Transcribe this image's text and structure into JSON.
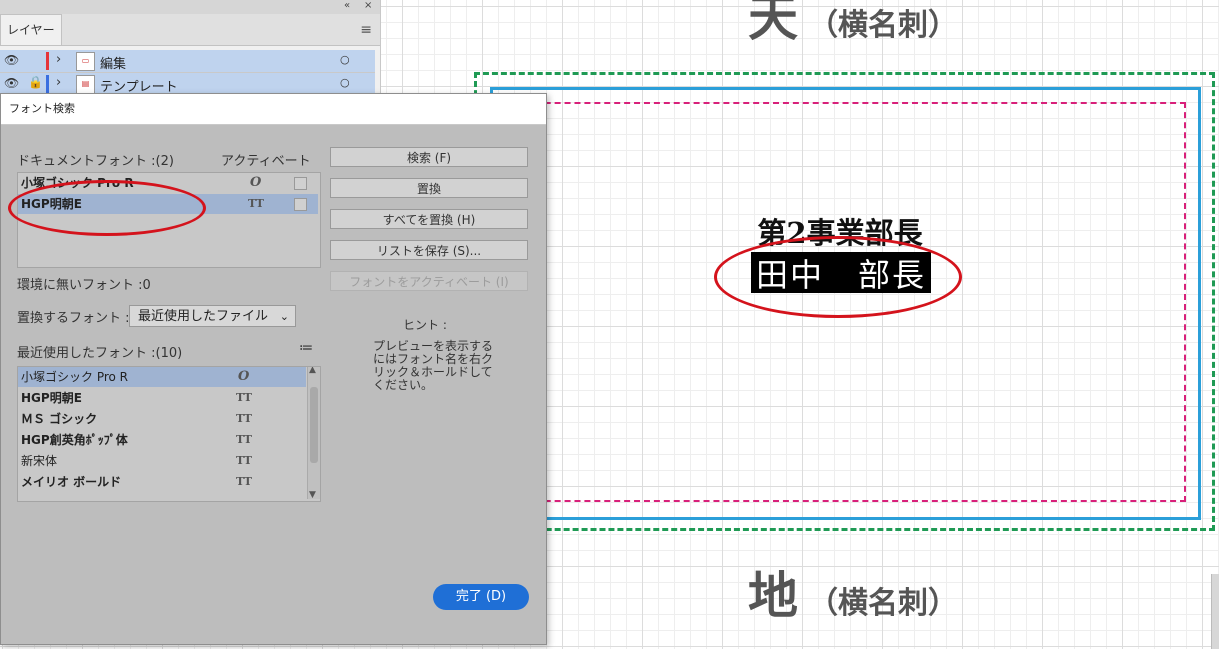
{
  "canvas": {
    "heading_top": {
      "big": "天",
      "small": "（横名刺）"
    },
    "heading_bottom": {
      "big": "地",
      "small": "（横名刺）"
    },
    "card_department": "第2事業部長",
    "card_name": "田中　部長"
  },
  "layers_panel": {
    "tab_label": "レイヤー",
    "collapse_icon": "«",
    "close_icon": "×",
    "menu_icon": "≡",
    "layers": [
      {
        "name": "編集",
        "color": "#e5343a",
        "locked": false
      },
      {
        "name": "テンプレート",
        "color": "#3a6fe0",
        "locked": true
      }
    ]
  },
  "dialog": {
    "title": "フォント検索",
    "document_fonts_label": "ドキュメントフォント :(2)",
    "activate_header": "アクティベート",
    "document_fonts": [
      {
        "name": "小塚ゴシック Pro R",
        "icon": "opentype-icon",
        "selected": false
      },
      {
        "name": "HGP明朝E",
        "icon": "truetype-icon",
        "selected": true
      }
    ],
    "missing_fonts_label": "環境に無いフォント :0",
    "replace_with_label": "置換するフォント :",
    "replace_with_value": "最近使用したファイル",
    "recent_fonts_label": "最近使用したフォント :(10)",
    "recent_fonts": [
      {
        "name": "小塚ゴシック Pro R",
        "icon": "opentype-icon",
        "selected": true
      },
      {
        "name": "HGP明朝E",
        "icon": "truetype-icon",
        "selected": false
      },
      {
        "name": "ＭＳ ゴシック",
        "icon": "truetype-icon",
        "selected": false
      },
      {
        "name": "HGP創英角ﾎﾟｯﾌﾟ体",
        "icon": "truetype-icon",
        "selected": false
      },
      {
        "name": "新宋体",
        "icon": "truetype-icon",
        "selected": false
      },
      {
        "name": "メイリオ ボールド",
        "icon": "truetype-icon",
        "selected": false
      }
    ],
    "buttons": {
      "find": "検索 (F)",
      "replace": "置換",
      "replace_all": "すべてを置換 (H)",
      "save_list": "リストを保存 (S)...",
      "activate_fonts": "フォントをアクティベート (I)",
      "done": "完了 (D)"
    },
    "hint_title": "ヒント :",
    "hint_text": "プレビューを表示するにはフォント名を右クリック＆ホールドしてください。",
    "icons": {
      "opentype": "O",
      "truetype": "TT",
      "list_view": "≔"
    }
  }
}
